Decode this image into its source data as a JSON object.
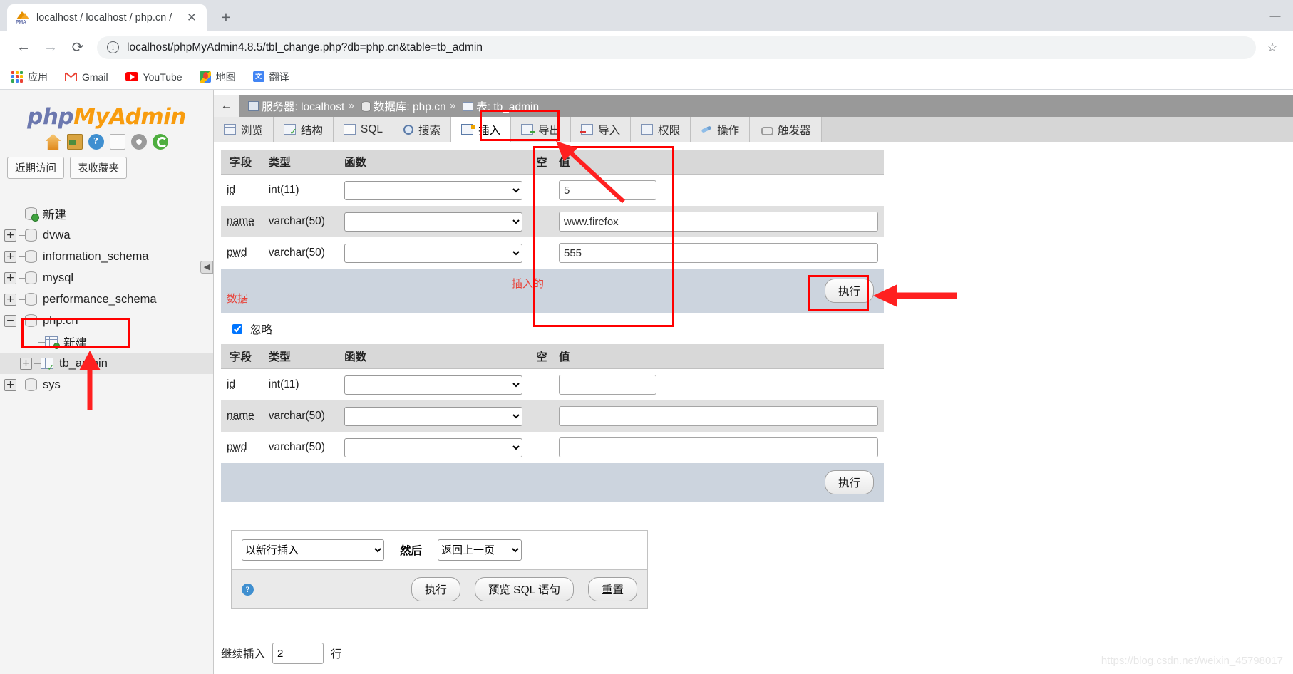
{
  "browser": {
    "tab_title": "localhost / localhost / php.cn /",
    "tab_close": "✕",
    "new_tab": "+",
    "back": "←",
    "forward": "→",
    "reload": "⟳",
    "info_icon": "ⓘ",
    "url": "localhost/phpMyAdmin4.8.5/tbl_change.php?db=php.cn&table=tb_admin",
    "star": "☆",
    "minimize": "—",
    "bookmarks": [
      {
        "label": "应用",
        "icon": "apps-grid-icon"
      },
      {
        "label": "Gmail",
        "icon": "gmail-icon"
      },
      {
        "label": "YouTube",
        "icon": "youtube-icon"
      },
      {
        "label": "地图",
        "icon": "maps-icon"
      },
      {
        "label": "翻译",
        "icon": "translate-icon"
      }
    ]
  },
  "sidebar": {
    "logo": {
      "php": "php",
      "my": "My",
      "admin": "Admin"
    },
    "quick_icons": [
      "home-icon",
      "logout-icon",
      "help-icon",
      "docs-icon",
      "settings-icon",
      "reload-icon"
    ],
    "tabs": [
      {
        "label": "近期访问"
      },
      {
        "label": "表收藏夹"
      }
    ],
    "collapse_icon": "◀",
    "tree": [
      {
        "label": "新建",
        "level": 1,
        "toggle": "",
        "icon": "new-database-icon",
        "selected": false
      },
      {
        "label": "dvwa",
        "level": 1,
        "toggle": "+",
        "icon": "database-icon",
        "selected": false
      },
      {
        "label": "information_schema",
        "level": 1,
        "toggle": "+",
        "icon": "database-icon",
        "selected": false
      },
      {
        "label": "mysql",
        "level": 1,
        "toggle": "+",
        "icon": "database-icon",
        "selected": false
      },
      {
        "label": "performance_schema",
        "level": 1,
        "toggle": "+",
        "icon": "database-icon",
        "selected": false
      },
      {
        "label": "php.cn",
        "level": 1,
        "toggle": "−",
        "icon": "database-icon",
        "selected": false
      },
      {
        "label": "新建",
        "level": 2,
        "toggle": "",
        "icon": "new-table-icon",
        "selected": false
      },
      {
        "label": "tb_admin",
        "level": 2,
        "toggle": "+",
        "icon": "table-icon",
        "selected": true
      },
      {
        "label": "sys",
        "level": 1,
        "toggle": "+",
        "icon": "database-icon",
        "selected": false
      }
    ]
  },
  "breadcrumb": {
    "back_icon": "←",
    "server_label": "服务器: localhost",
    "sep": "»",
    "db_label": "数据库: php.cn",
    "table_label": "表: tb_admin"
  },
  "tabs": [
    {
      "label": "浏览",
      "icon": "browse-icon",
      "active": false
    },
    {
      "label": "结构",
      "icon": "structure-icon",
      "active": false
    },
    {
      "label": "SQL",
      "icon": "sql-icon",
      "active": false
    },
    {
      "label": "搜索",
      "icon": "search-icon",
      "active": false
    },
    {
      "label": "插入",
      "icon": "insert-icon",
      "active": true
    },
    {
      "label": "导出",
      "icon": "export-icon",
      "active": false
    },
    {
      "label": "导入",
      "icon": "import-icon",
      "active": false
    },
    {
      "label": "权限",
      "icon": "privileges-icon",
      "active": false
    },
    {
      "label": "操作",
      "icon": "operations-icon",
      "active": false
    },
    {
      "label": "触发器",
      "icon": "triggers-icon",
      "active": false
    }
  ],
  "form": {
    "headers": [
      "字段",
      "类型",
      "函数",
      "空",
      "值"
    ],
    "run_label": "执行",
    "annotation_label": "插入的数据",
    "ignore_label": "忽略",
    "ignore_checked": true,
    "row1": [
      {
        "field": "id",
        "type": "int(11)",
        "func": "",
        "value": "5",
        "size": "small"
      },
      {
        "field": "name",
        "type": "varchar(50)",
        "func": "",
        "value": "www.firefox",
        "size": "big"
      },
      {
        "field": "pwd",
        "type": "varchar(50)",
        "func": "",
        "value": "555",
        "size": "big"
      }
    ],
    "row2": [
      {
        "field": "id",
        "type": "int(11)",
        "func": "",
        "value": "",
        "size": "small"
      },
      {
        "field": "name",
        "type": "varchar(50)",
        "func": "",
        "value": "",
        "size": "big"
      },
      {
        "field": "pwd",
        "type": "varchar(50)",
        "func": "",
        "value": "",
        "size": "big"
      }
    ]
  },
  "bottom_panel": {
    "insert_mode": "以新行插入",
    "then_label": "然后",
    "after_action": "返回上一页",
    "help_icon": "?",
    "run_label": "执行",
    "preview_label": "预览 SQL 语句",
    "reset_label": "重置"
  },
  "continue": {
    "prefix": "继续插入",
    "rows": "2",
    "suffix": "行"
  },
  "watermark": "https://blog.csdn.net/weixin_45798017",
  "colors": {
    "annotation_red": "#ff0000",
    "annotation_text_red": "#e8433a",
    "pma_orange": "#f89c0e",
    "pma_blue": "#6c78af",
    "breadcrumb_gray": "#999999"
  }
}
